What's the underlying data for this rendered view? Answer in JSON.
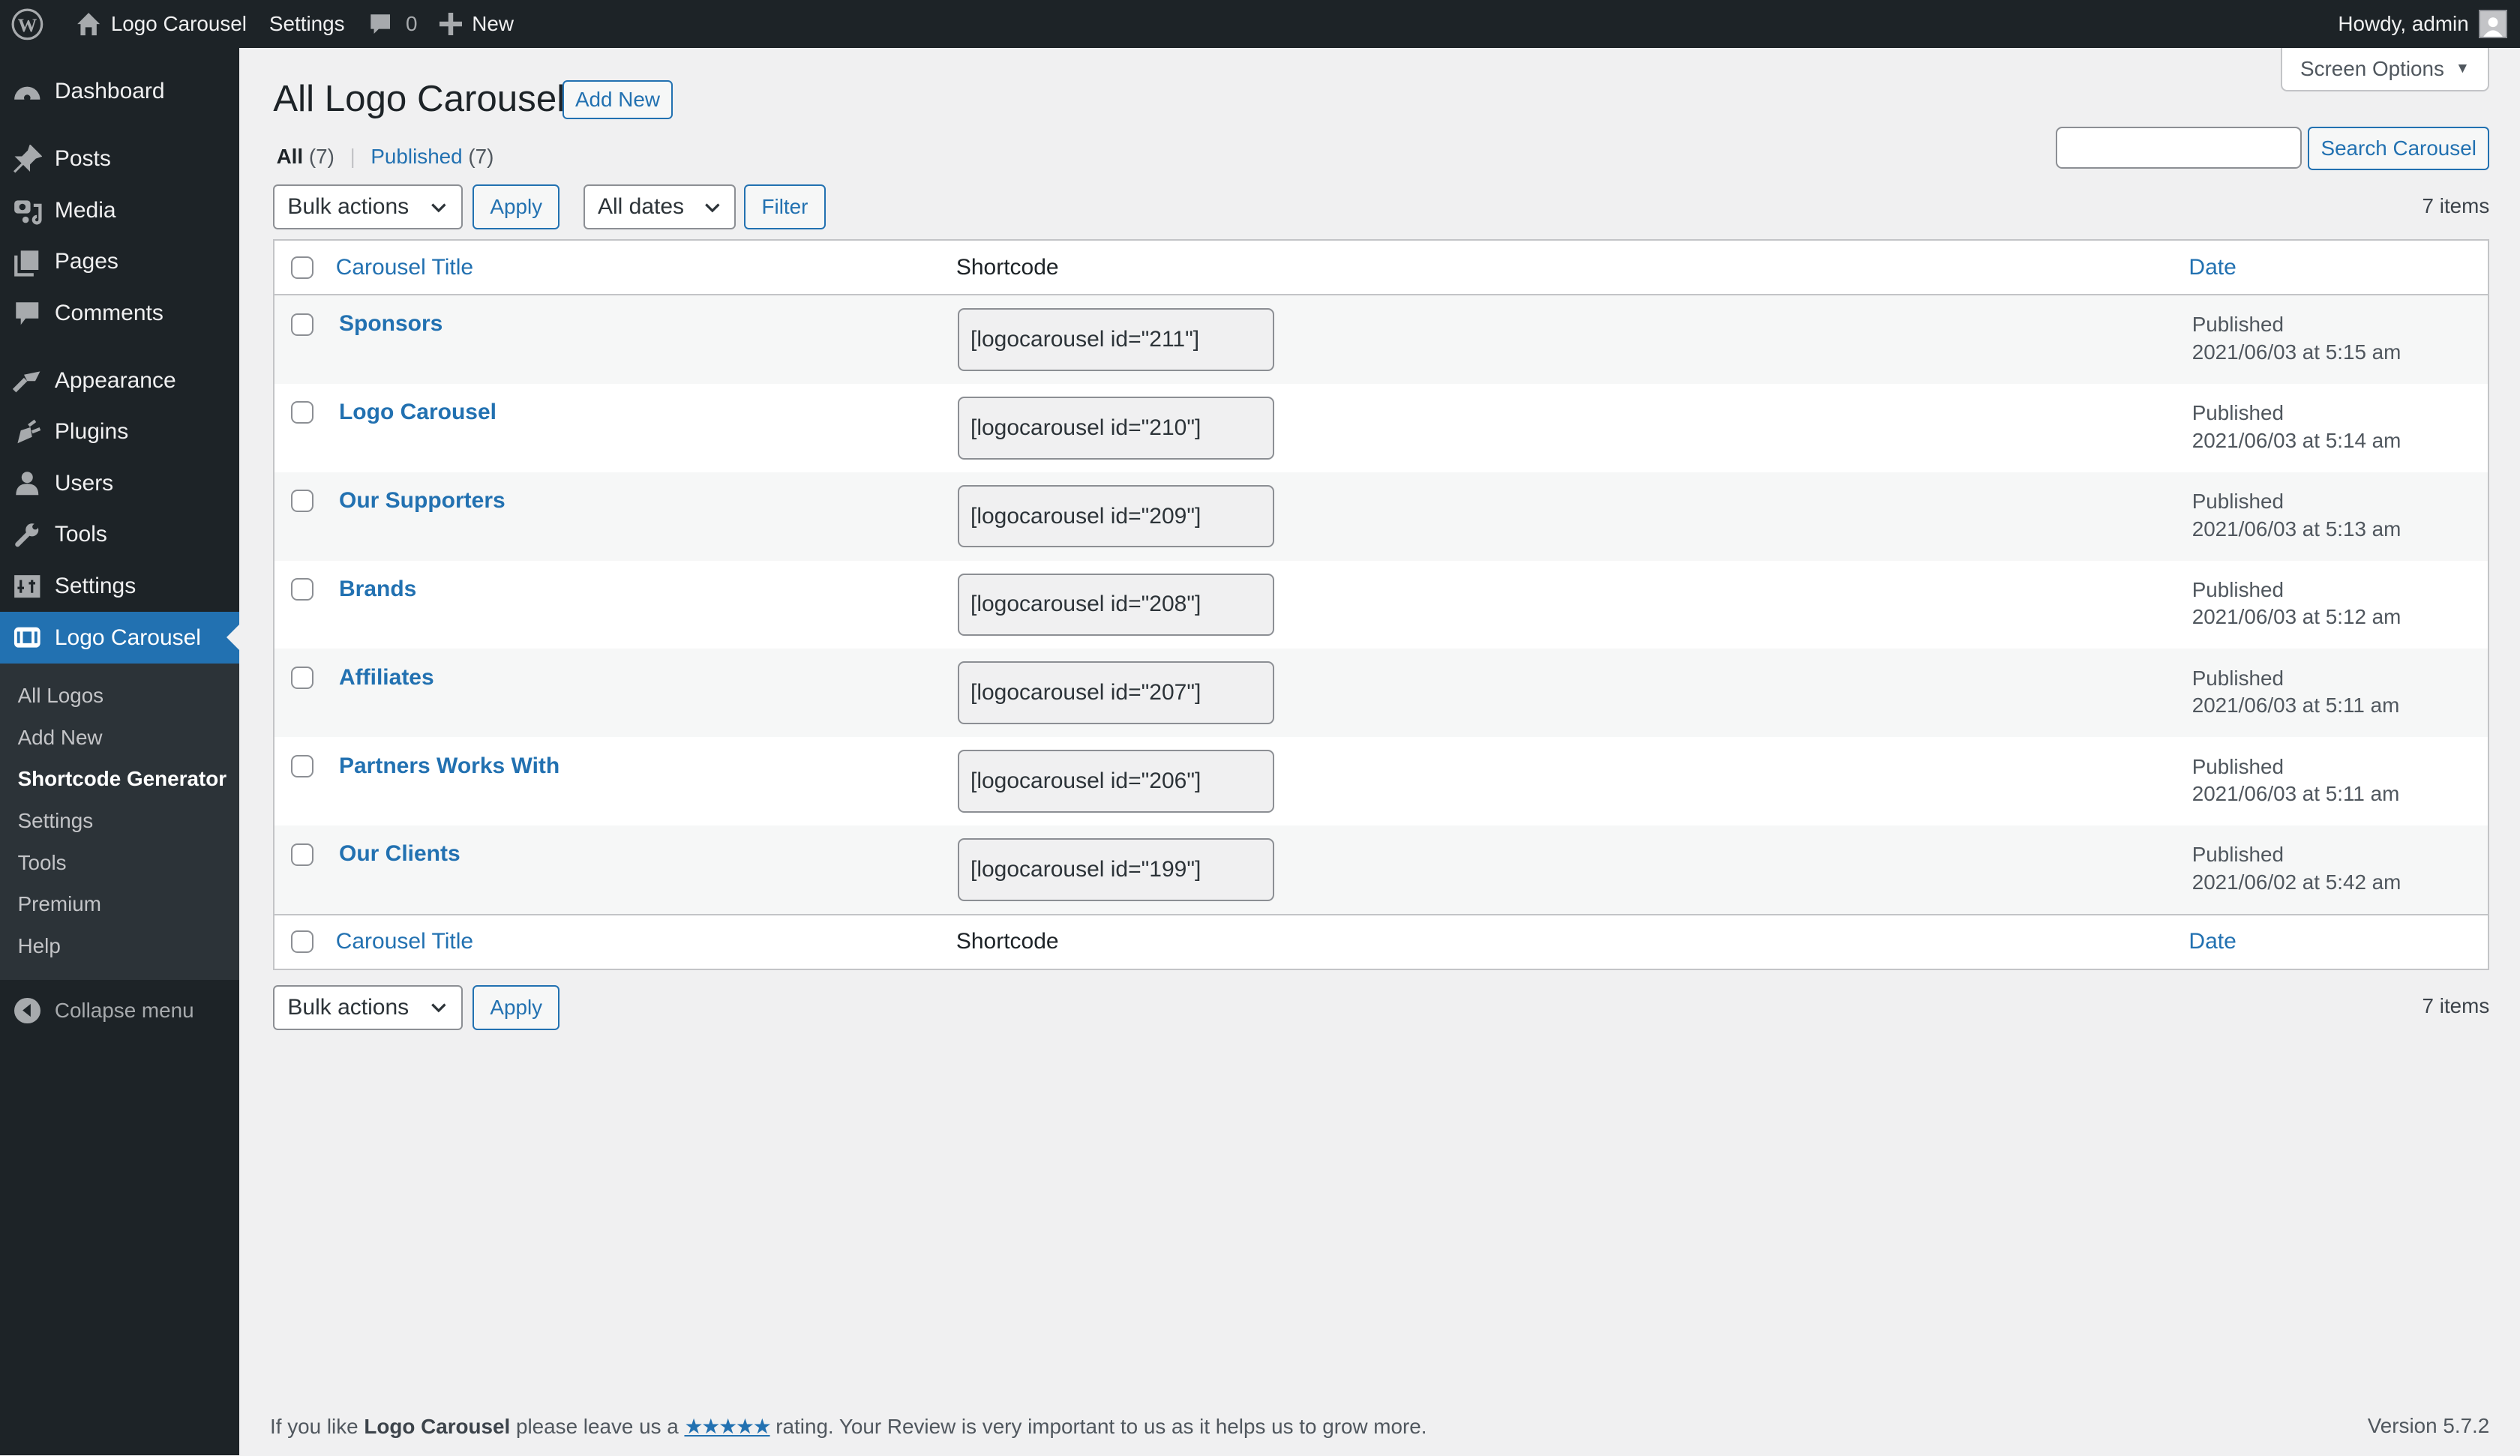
{
  "admin_bar": {
    "site_name": "Logo Carousel",
    "settings": "Settings",
    "comments_count": "0",
    "new_label": "New",
    "howdy": "Howdy, admin"
  },
  "sidebar": {
    "menu": [
      {
        "label": "Dashboard",
        "icon": "dashboard-icon"
      },
      {
        "label": "Posts",
        "icon": "pin-icon"
      },
      {
        "label": "Media",
        "icon": "media-icon"
      },
      {
        "label": "Pages",
        "icon": "pages-icon"
      },
      {
        "label": "Comments",
        "icon": "comment-icon"
      },
      {
        "label": "Appearance",
        "icon": "paintbrush-icon"
      },
      {
        "label": "Plugins",
        "icon": "plugin-icon"
      },
      {
        "label": "Users",
        "icon": "user-icon"
      },
      {
        "label": "Tools",
        "icon": "wrench-icon"
      },
      {
        "label": "Settings",
        "icon": "settings-icon"
      },
      {
        "label": "Logo Carousel",
        "icon": "carousel-icon",
        "active": true
      }
    ],
    "submenu": [
      {
        "label": "All Logos"
      },
      {
        "label": "Add New"
      },
      {
        "label": "Shortcode Generator",
        "current": true
      },
      {
        "label": "Settings"
      },
      {
        "label": "Tools"
      },
      {
        "label": "Premium"
      },
      {
        "label": "Help"
      }
    ],
    "collapse_label": "Collapse menu"
  },
  "header": {
    "screen_options": "Screen Options",
    "title": "All Logo Carousels",
    "add_new": "Add New"
  },
  "filters": {
    "all_label": "All",
    "all_count": "(7)",
    "published_label": "Published",
    "published_count": "(7)",
    "search_value": "",
    "search_button": "Search Carousel",
    "bulk_actions": "Bulk actions",
    "apply": "Apply",
    "all_dates": "All dates",
    "filter": "Filter",
    "items_count": "7 items"
  },
  "table": {
    "columns": {
      "title": "Carousel Title",
      "shortcode": "Shortcode",
      "date": "Date"
    },
    "rows": [
      {
        "title": "Sponsors",
        "shortcode": "[logocarousel id=\"211\"]",
        "status": "Published",
        "date": "2021/06/03 at 5:15 am"
      },
      {
        "title": "Logo Carousel",
        "shortcode": "[logocarousel id=\"210\"]",
        "status": "Published",
        "date": "2021/06/03 at 5:14 am"
      },
      {
        "title": "Our Supporters",
        "shortcode": "[logocarousel id=\"209\"]",
        "status": "Published",
        "date": "2021/06/03 at 5:13 am"
      },
      {
        "title": "Brands",
        "shortcode": "[logocarousel id=\"208\"]",
        "status": "Published",
        "date": "2021/06/03 at 5:12 am"
      },
      {
        "title": "Affiliates",
        "shortcode": "[logocarousel id=\"207\"]",
        "status": "Published",
        "date": "2021/06/03 at 5:11 am"
      },
      {
        "title": "Partners Works With",
        "shortcode": "[logocarousel id=\"206\"]",
        "status": "Published",
        "date": "2021/06/03 at 5:11 am"
      },
      {
        "title": "Our Clients",
        "shortcode": "[logocarousel id=\"199\"]",
        "status": "Published",
        "date": "2021/06/02 at 5:42 am"
      }
    ]
  },
  "footer": {
    "text_before": "If you like ",
    "plugin_name": "Logo Carousel",
    "text_mid": " please leave us a ",
    "stars": "★★★★★",
    "text_after": " rating. Your Review is very important to us as it helps us to grow more.",
    "version": "Version 5.7.2"
  },
  "colors": {
    "accent": "#2271b1",
    "adminbar": "#1d2327",
    "submenu": "#2c3338",
    "background": "#f0f0f1"
  }
}
